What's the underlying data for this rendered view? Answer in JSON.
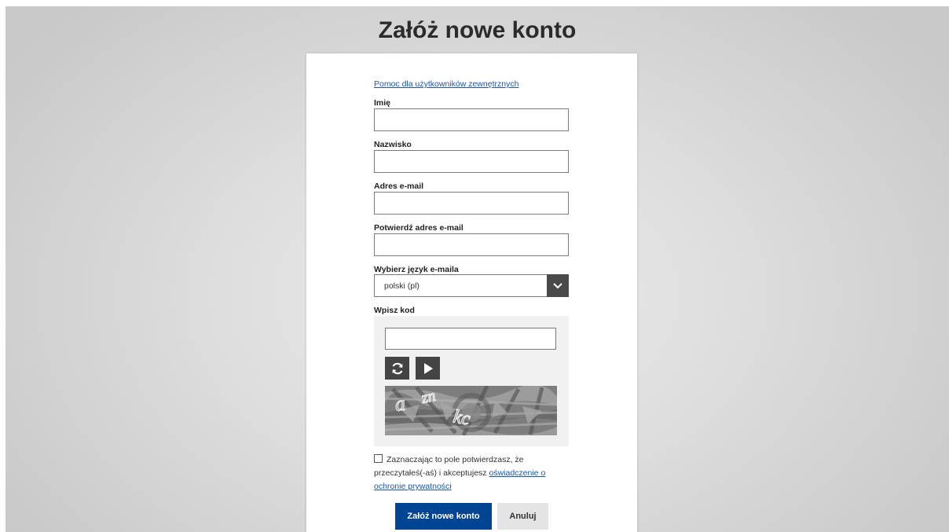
{
  "page": {
    "title": "Załóż nowe konto"
  },
  "form": {
    "help_link": "Pomoc dla użytkowników zewnętrznych",
    "first_name": {
      "label": "Imię",
      "value": ""
    },
    "last_name": {
      "label": "Nazwisko",
      "value": ""
    },
    "email": {
      "label": "Adres e-mail",
      "value": ""
    },
    "confirm_email": {
      "label": "Potwierdź adres e-mail",
      "value": ""
    },
    "language": {
      "label": "Wybierz język e-maila",
      "selected": "polski (pl)"
    },
    "captcha": {
      "label": "Wpisz kod",
      "value": "",
      "refresh_icon": "refresh-icon",
      "audio_icon": "play-icon",
      "image_text": "a zn kc"
    },
    "consent": {
      "checked": false,
      "text": "Zaznaczając to pole potwierdzasz, że przeczytałeś(-aś) i akceptujesz",
      "link": "oświadczenie o ochronie prywatności"
    },
    "buttons": {
      "submit": "Załóż nowe konto",
      "cancel": "Anuluj"
    }
  },
  "colors": {
    "primary": "#004494",
    "link": "#1d57a5",
    "dark_button": "#444444"
  }
}
